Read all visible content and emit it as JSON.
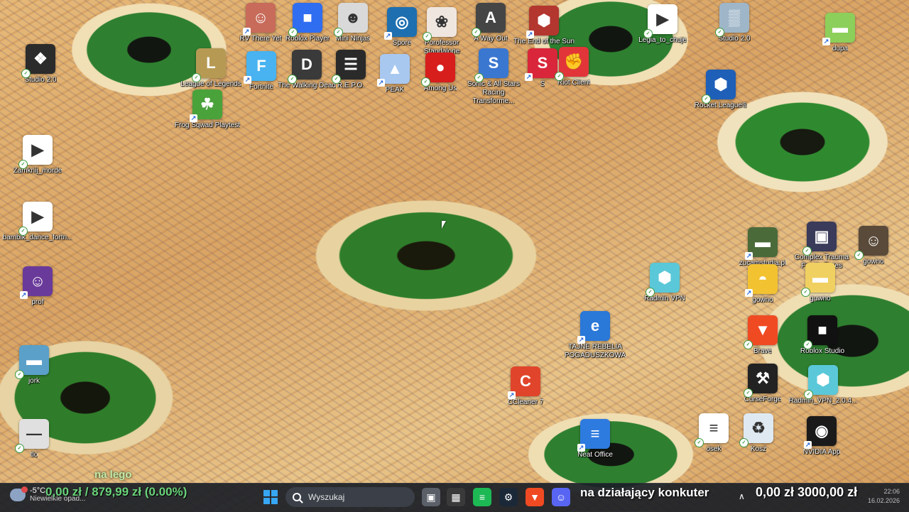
{
  "desktop": {
    "icons": [
      {
        "label": "RV There Yet",
        "icon": "rv-there-yet-icon",
        "color": "#c86b5a",
        "glyph": "☺"
      },
      {
        "label": "Roblox Player",
        "icon": "roblox-icon",
        "color": "#2f6df1",
        "glyph": "■"
      },
      {
        "label": "Mini Ninjas",
        "icon": "mini-ninjas-icon",
        "color": "#d9d9d9",
        "glyph": "☻"
      },
      {
        "label": "Spore",
        "icon": "spore-icon",
        "color": "#1e6fb0",
        "glyph": "◎"
      },
      {
        "label": "Porofessor Standalone",
        "icon": "porofessor-icon",
        "color": "#f0e6e0",
        "glyph": "❀"
      },
      {
        "label": "A Way Out",
        "icon": "a-way-out-icon",
        "color": "#454545",
        "glyph": "A"
      },
      {
        "label": "The End of the Sun",
        "icon": "end-of-sun-icon",
        "color": "#b3362f",
        "glyph": "⬢"
      },
      {
        "label": "Legia_to_chuje",
        "icon": "video-file-icon",
        "color": "#ffffff",
        "glyph": "▶"
      },
      {
        "label": "Studio 2.0",
        "icon": "studio-computer-icon",
        "color": "#9fb6c8",
        "glyph": "▒"
      },
      {
        "label": "dupa",
        "icon": "image-file-icon",
        "color": "#8ccf5a",
        "glyph": "▬"
      },
      {
        "label": "Studio 2.0",
        "icon": "studio-logo-icon",
        "color": "#2b2b2b",
        "glyph": "❖"
      },
      {
        "label": "League of Legends",
        "icon": "league-of-legends-icon",
        "color": "#b69a54",
        "glyph": "L"
      },
      {
        "label": "Fortnite",
        "icon": "fortnite-icon",
        "color": "#48b3f0",
        "glyph": "F"
      },
      {
        "label": "The Walking Dead",
        "icon": "walking-dead-icon",
        "color": "#3a3a3a",
        "glyph": "D"
      },
      {
        "label": "R.E.P.O.",
        "icon": "repo-icon",
        "color": "#2a2a2a",
        "glyph": "☰"
      },
      {
        "label": "PEAK",
        "icon": "peak-icon",
        "color": "#a8c8f0",
        "glyph": "▲"
      },
      {
        "label": "Among Us",
        "icon": "among-us-icon",
        "color": "#d81d1d",
        "glyph": "●"
      },
      {
        "label": "Sonic & All Stars Racing Transforme...",
        "icon": "sonic-racing-icon",
        "color": "#3a77d0",
        "glyph": "S"
      },
      {
        "label": "S",
        "icon": "s-game-icon",
        "color": "#d9263a",
        "glyph": "S"
      },
      {
        "label": "Riot Client",
        "icon": "riot-client-icon",
        "color": "#e1353a",
        "glyph": "✊"
      },
      {
        "label": "Rocket League®",
        "icon": "rocket-league-icon",
        "color": "#1e5fb8",
        "glyph": "⬢"
      },
      {
        "label": "Frog Sqwad Playtest",
        "icon": "frog-sqwad-icon",
        "color": "#4aa23a",
        "glyph": "☘"
      },
      {
        "label": "Zamknij_morde",
        "icon": "video-file-icon",
        "color": "#ffffff",
        "glyph": "▶"
      },
      {
        "label": "bambik_dance_fortn...",
        "icon": "video-file-icon",
        "color": "#ffffff",
        "glyph": "▶"
      },
      {
        "label": "prof",
        "icon": "photo-file-icon",
        "color": "#6a3a9a",
        "glyph": "☺"
      },
      {
        "label": "jork",
        "icon": "image-file-icon",
        "color": "#5aa0c8",
        "glyph": "▬"
      },
      {
        "label": "tlo",
        "icon": "image-file-icon",
        "color": "#e0e0e0",
        "glyph": "—"
      },
      {
        "label": "zucamstudia.pl",
        "icon": "image-file-icon",
        "color": "#4a6a3a",
        "glyph": "▬"
      },
      {
        "label": "Complex Trauma Family Roles",
        "icon": "image-file-icon",
        "color": "#3a3a5a",
        "glyph": "▣"
      },
      {
        "label": "gowno",
        "icon": "photo-file-icon",
        "color": "#5a4a3a",
        "glyph": "☺"
      },
      {
        "label": "gowno",
        "icon": "image-file-icon",
        "color": "#f2c230",
        "glyph": "◓"
      },
      {
        "label": "guwno",
        "icon": "image-file-icon",
        "color": "#f0d060",
        "glyph": "▬"
      },
      {
        "label": "Radmin VPN",
        "icon": "radmin-vpn-icon",
        "color": "#5ac8d8",
        "glyph": "⬢"
      },
      {
        "label": "TAJNE REBELIA POGADUSZKOWA",
        "icon": "internet-explorer-icon",
        "color": "#2a78d8",
        "glyph": "e"
      },
      {
        "label": "Brave",
        "icon": "brave-icon",
        "color": "#f04a23",
        "glyph": "▼"
      },
      {
        "label": "Roblox Studio",
        "icon": "roblox-studio-icon",
        "color": "#111111",
        "glyph": "■"
      },
      {
        "label": "CCleaner 7",
        "icon": "ccleaner-icon",
        "color": "#e0452b",
        "glyph": "C"
      },
      {
        "label": "CurseForge",
        "icon": "curseforge-icon",
        "color": "#222222",
        "glyph": "⚒"
      },
      {
        "label": "Radmin_VPN_2.0.4...",
        "icon": "radmin-installer-icon",
        "color": "#5ac8d8",
        "glyph": "⬢"
      },
      {
        "label": "Neat Office",
        "icon": "neat-office-icon",
        "color": "#2e7be0",
        "glyph": "≡"
      },
      {
        "label": "osek",
        "icon": "document-file-icon",
        "color": "#ffffff",
        "glyph": "≡"
      },
      {
        "label": "Kosz",
        "icon": "recycle-bin-icon",
        "color": "#dfe9f2",
        "glyph": "♻"
      },
      {
        "label": "NVIDIA App",
        "icon": "nvidia-app-icon",
        "color": "#1a1a1a",
        "glyph": "◉"
      }
    ],
    "overlay_text": "na lego"
  },
  "taskbar": {
    "weather": {
      "temp": "-5°C",
      "condition": "Niewielkie opad..."
    },
    "stream_left": "0,00 zł / 879,99 zł (0.00%)",
    "search_placeholder": "Wyszukaj",
    "stream_center": "na działający konkuter",
    "stream_right": "0,00 zł  3000,00 zł",
    "clock_time": "22:06",
    "clock_date": "16.02.2026",
    "apps": [
      {
        "name": "task-view-icon",
        "color": "#5a5f68",
        "glyph": "▣"
      },
      {
        "name": "minecraft-icon",
        "color": "#3a3a3a",
        "glyph": "▦"
      },
      {
        "name": "spotify-icon",
        "color": "#1db954",
        "glyph": "≡"
      },
      {
        "name": "steam-icon",
        "color": "#1b2838",
        "glyph": "⚙"
      },
      {
        "name": "brave-taskbar-icon",
        "color": "#f04a23",
        "glyph": "▼"
      },
      {
        "name": "discord-icon",
        "color": "#5865f2",
        "glyph": "☺"
      }
    ]
  }
}
